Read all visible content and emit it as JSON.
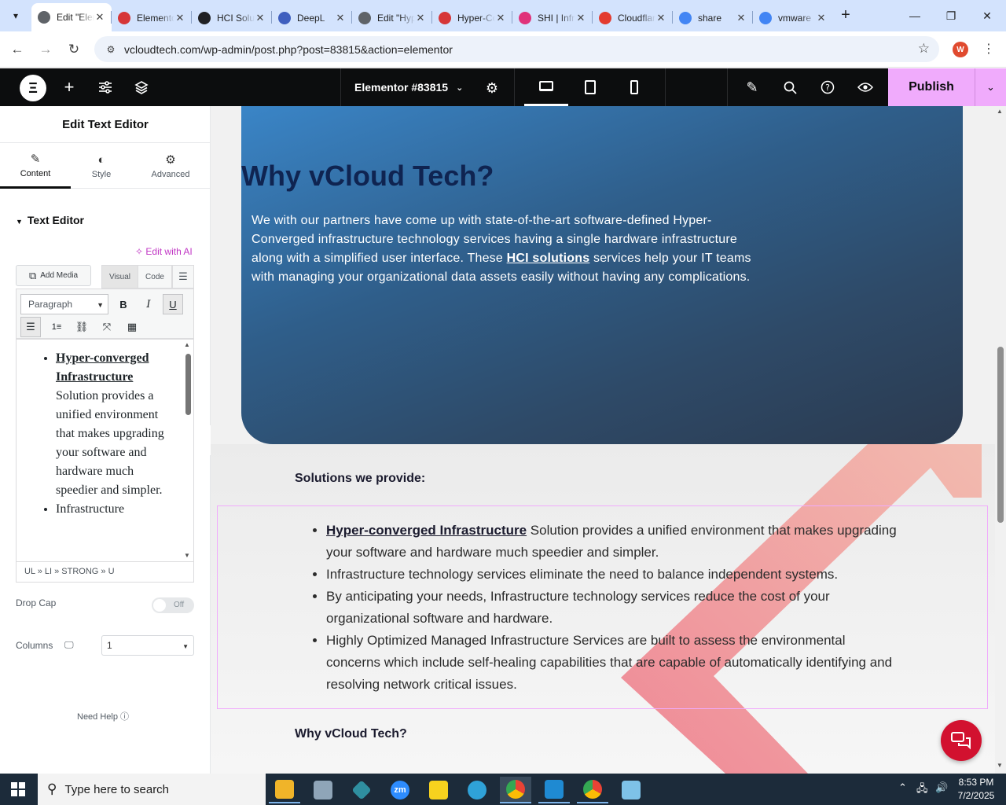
{
  "browser": {
    "tabs": [
      {
        "title": "Edit \"Elementor",
        "color": "#5f6368",
        "icon": "globe-icon"
      },
      {
        "title": "Elementor",
        "color": "#d63638",
        "icon": "diamond-icon"
      },
      {
        "title": "HCI Solutions",
        "color": "#202124",
        "icon": "circle-icon"
      },
      {
        "title": "DeepL",
        "color": "#3f5fbf",
        "icon": "bird-icon"
      },
      {
        "title": "Edit \"Hyper",
        "color": "#5f6368",
        "icon": "globe-icon"
      },
      {
        "title": "Hyper-Converged",
        "color": "#d63638",
        "icon": "diamond-icon"
      },
      {
        "title": "SHI | Infra",
        "color": "#e0327a",
        "icon": "ring-icon"
      },
      {
        "title": "Cloudflare",
        "color": "#e33b2f",
        "icon": "swoosh-icon"
      },
      {
        "title": "share",
        "color": "#4285f4",
        "icon": "google-icon"
      },
      {
        "title": "vmware",
        "color": "#4285f4",
        "icon": "google-icon"
      }
    ],
    "url": "vcloudtech.com/wp-admin/post.php?post=83815&action=elementor",
    "profile_initial": "W"
  },
  "elementor": {
    "document_title": "Elementor #83815",
    "publish_label": "Publish"
  },
  "panel": {
    "title": "Edit Text Editor",
    "tabs": [
      "Content",
      "Style",
      "Advanced"
    ],
    "section": "Text Editor",
    "edit_ai": "Edit with AI",
    "add_media": "Add Media",
    "visual_tab": "Visual",
    "code_tab": "Code",
    "paragraph": "Paragraph",
    "content_item1_strong": "Hyper-converged Infrastructure",
    "content_item1_rest": "Solution provides a unified environment that makes upgrading your software and hardware much speedier and simpler.",
    "content_item2": "Infrastructure",
    "path": "UL » LI » STRONG » U",
    "drop_cap_label": "Drop Cap",
    "drop_cap_value": "Off",
    "columns_label": "Columns",
    "columns_value": "1",
    "need_help": "Need Help"
  },
  "canvas": {
    "hero_title": "Why vCloud Tech?",
    "hero_text_1": "We with our partners have come up with state-of-the-art software-defined Hyper-Converged infrastructure technology services having a single hardware infrastructure along with a simplified user interface. These ",
    "hero_link": "HCI solutions",
    "hero_text_2": " services help your IT teams with managing your organizational data assets easily without having any complications.",
    "solutions_heading": "Solutions we provide:",
    "solutions": [
      {
        "strong": "Hyper-converged Infrastructure",
        "text": " Solution provides a unified environment that makes upgrading your software and hardware much speedier and simpler."
      },
      {
        "strong": "",
        "text": "Infrastructure technology services eliminate the need to balance independent systems."
      },
      {
        "strong": "",
        "text": "By anticipating your needs, Infrastructure technology services reduce the cost of your organizational software and hardware."
      },
      {
        "strong": "",
        "text": "Highly Optimized Managed Infrastructure Services are built to assess the environmental concerns which include self-healing capabilities that are capable of automatically identifying and resolving network critical issues."
      }
    ],
    "why_heading_2": "Why vCloud Tech?"
  },
  "taskbar": {
    "search_placeholder": "Type here to search",
    "time": "8:53 PM",
    "date": "7/2/2025"
  },
  "colors": {
    "publish": "#f0abfc",
    "selection": "#f0abfc",
    "chat": "#d2112f"
  }
}
